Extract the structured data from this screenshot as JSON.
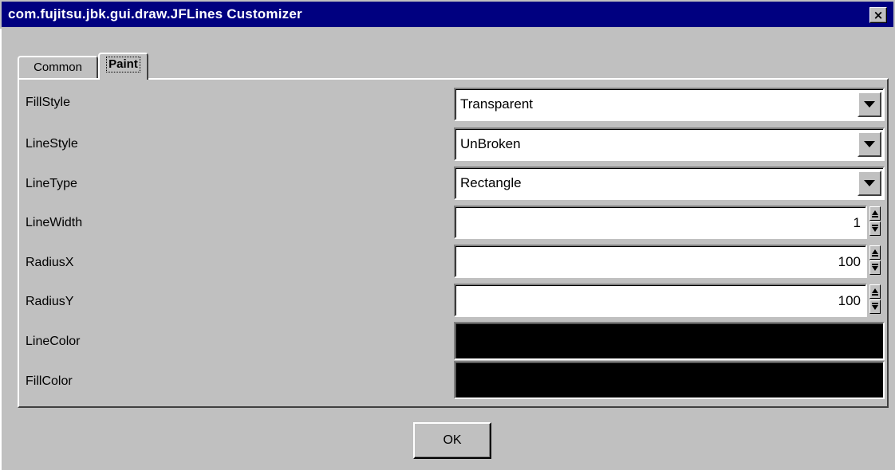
{
  "window": {
    "title": "com.fujitsu.jbk.gui.draw.JFLines Customizer",
    "close_icon": "×"
  },
  "tabs": [
    {
      "label": "Common",
      "selected": false
    },
    {
      "label": "Paint",
      "selected": true
    }
  ],
  "properties": {
    "fill_style": {
      "label": "FillStyle",
      "value": "Transparent"
    },
    "line_style": {
      "label": "LineStyle",
      "value": "UnBroken"
    },
    "line_type": {
      "label": "LineType",
      "value": "Rectangle"
    },
    "line_width": {
      "label": "LineWidth",
      "value": "1"
    },
    "radius_x": {
      "label": "RadiusX",
      "value": "100"
    },
    "radius_y": {
      "label": "RadiusY",
      "value": "100"
    },
    "line_color": {
      "label": "LineColor",
      "color": "#000000"
    },
    "fill_color": {
      "label": "FillColor",
      "color": "#000000"
    }
  },
  "buttons": {
    "ok_label": "OK"
  },
  "colors": {
    "title_bar": "#000080",
    "window_bg": "#c0c0c0"
  },
  "icons": [
    "close-icon",
    "dropdown-arrow-icon",
    "spinner-up-icon",
    "spinner-down-icon"
  ]
}
